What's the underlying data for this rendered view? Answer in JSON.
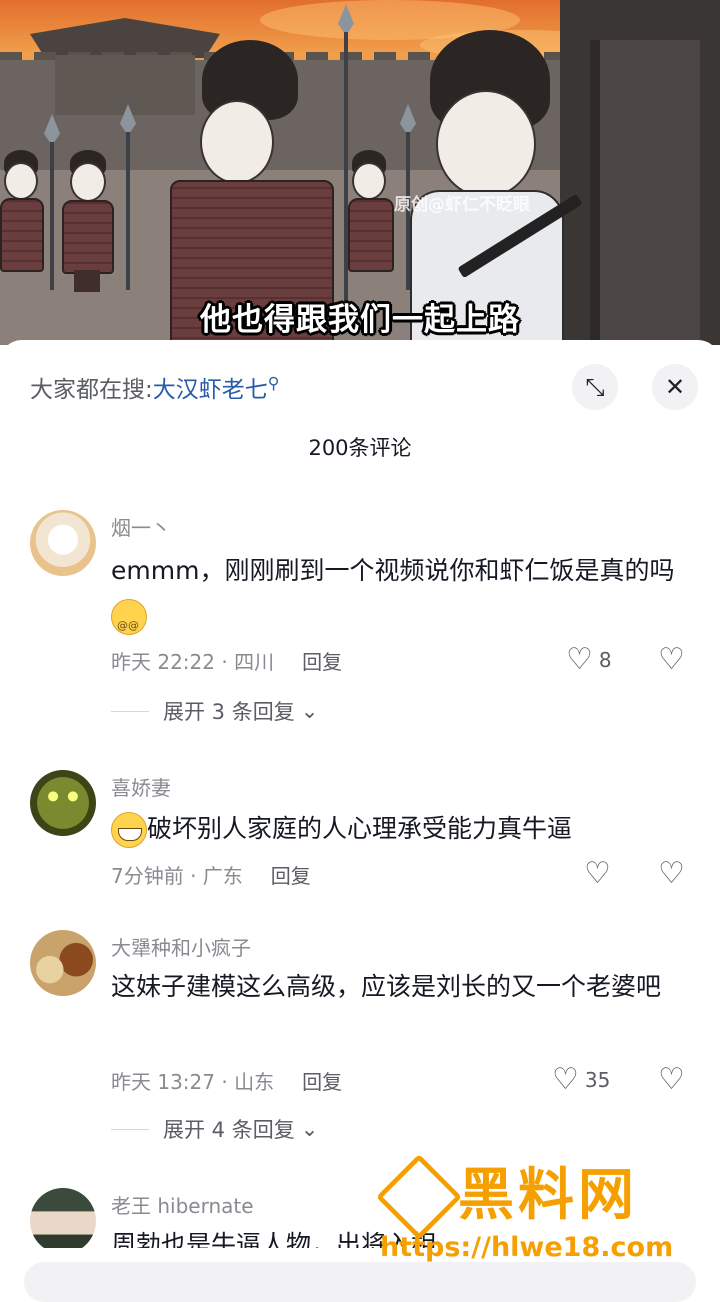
{
  "video": {
    "watermark": "原创@虾仁不眨眼",
    "subtitle": "他也得跟我们一起上路"
  },
  "panel": {
    "search_prefix": "大家都在搜:",
    "search_term": "大汉虾老七",
    "comment_count": "200条评论",
    "expand_icon": "expand-icon",
    "close_icon": "close-icon"
  },
  "comments": [
    {
      "username": "烟一丶",
      "text": "emmm，刚刚刷到一个视频说你和虾仁饭是真的吗",
      "emoji": "dizzy-emoji",
      "meta": "昨天 22:22 · 四川",
      "reply_label": "回复",
      "likes": "8",
      "expand": "展开 3 条回复"
    },
    {
      "username": "喜娇妻",
      "text": "破坏别人家庭的人心理承受能力真牛逼",
      "emoji": "grin-emoji",
      "meta": "7分钟前 · 广东",
      "reply_label": "回复",
      "likes": ""
    },
    {
      "username": "大犟种和小疯子",
      "text": "这妹子建模这么高级，应该是刘长的又一个老婆吧",
      "meta": "昨天 13:27 · 山东",
      "reply_label": "回复",
      "likes": "35",
      "expand": "展开 4 条回复"
    },
    {
      "username": "老王 hibernate",
      "text": "周勃也是牛逼人物，出将入相"
    }
  ],
  "overlay": {
    "brand": "黑料网",
    "url": "https://hlwe18.com",
    "brand_color": "#f5a000"
  }
}
